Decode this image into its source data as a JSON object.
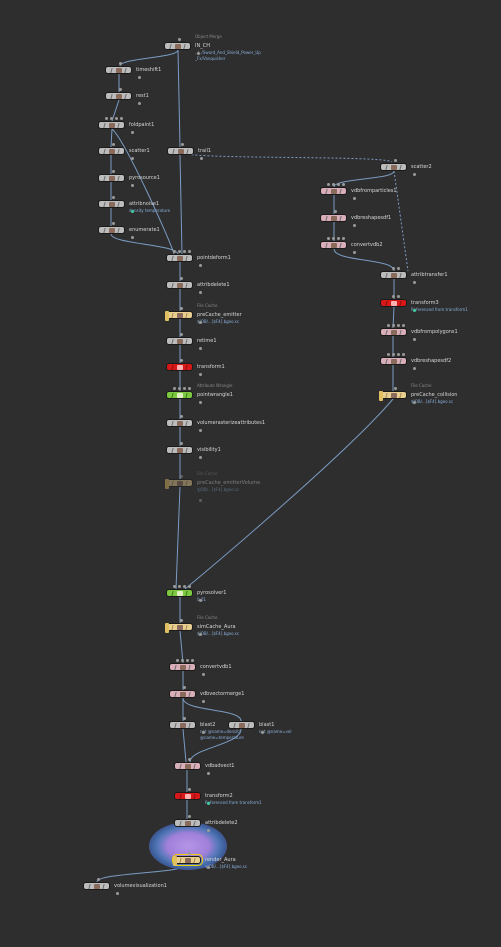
{
  "network": {
    "connection_color": "#7b9cc4",
    "nodes": [
      {
        "key": "in_ch",
        "label": "IN_CH",
        "type_label": "Object Merge",
        "info": "../../Sword_And_Shield_Power_Up",
        "info2": "_Fx/Vanquisher",
        "icon": "merge-icon",
        "color": "#bcbcbc"
      },
      {
        "key": "timeshift1",
        "label": "timeshift1",
        "icon": "clock-icon",
        "color": "#bcbcbc"
      },
      {
        "key": "rest1",
        "label": "rest1",
        "icon": "rest-icon",
        "color": "#bcbcbc"
      },
      {
        "key": "foldpaint1",
        "label": "foldpaint1",
        "icon": "paint-icon",
        "color": "#bcbcbc"
      },
      {
        "key": "scatter1",
        "label": "scatter1",
        "icon": "scatter-icon",
        "color": "#bcbcbc"
      },
      {
        "key": "pyrosource1",
        "label": "pyrosource1",
        "icon": "fire-icon",
        "color": "#bcbcbc"
      },
      {
        "key": "attribnoise1",
        "label": "attribnoise1",
        "info": "density temperature",
        "icon": "noise-icon",
        "color": "#bcbcbc"
      },
      {
        "key": "enumerate1",
        "label": "enumerate1",
        "icon": "enumerate-icon",
        "color": "#bcbcbc"
      },
      {
        "key": "trail1",
        "label": "trail1",
        "icon": "trail-icon",
        "color": "#bcbcbc"
      },
      {
        "key": "pointdeform1",
        "label": "pointdeform1",
        "icon": "deform-icon",
        "color": "#bcbcbc"
      },
      {
        "key": "attribdelete1",
        "label": "attribdelete1",
        "icon": "delete-attr-icon",
        "color": "#bcbcbc"
      },
      {
        "key": "precache_emitter",
        "label": "preCache_emitter",
        "type_label": "File Cache",
        "info": "$JOB/...[$F4].bgeo.sc",
        "icon": "file-cache-icon",
        "color": "#e8cf90"
      },
      {
        "key": "retime1",
        "label": "retime1",
        "icon": "retime-icon",
        "color": "#bcbcbc"
      },
      {
        "key": "transform1",
        "label": "transform1",
        "icon": "transform-icon",
        "color": "#d81818"
      },
      {
        "key": "pointwrangle1",
        "label": "pointwrangle1",
        "type_label": "Attribute Wrangle",
        "icon": "wrangle-icon",
        "color": "#7cc840"
      },
      {
        "key": "volumerasterize",
        "label": "volumerasterizeattributes1",
        "icon": "volume-icon",
        "color": "#bcbcbc"
      },
      {
        "key": "visibility1",
        "label": "visibility1",
        "icon": "eye-icon",
        "color": "#bcbcbc"
      },
      {
        "key": "precache_emitter_volume",
        "label": "preCache_emitterVolume",
        "type_label": "File Cache",
        "info": "$JOB/...[$F4].bgeo.sc",
        "icon": "file-cache-icon",
        "color": "#e8cf90"
      },
      {
        "key": "scatter2",
        "label": "scatter2",
        "icon": "scatter-icon",
        "color": "#bcbcbc"
      },
      {
        "key": "vdbfromparticles",
        "label": "vdbfromparticles1",
        "icon": "vdb-icon",
        "color": "#d9aeb8"
      },
      {
        "key": "vdbreshapesdf1",
        "label": "vdbreshapesdf1",
        "icon": "vdb-icon",
        "color": "#d9aeb8"
      },
      {
        "key": "convertvdb2",
        "label": "convertvdb2",
        "icon": "vdb-icon",
        "color": "#d9aeb8"
      },
      {
        "key": "attribtransfer1",
        "label": "attribtransfer1",
        "icon": "transfer-icon",
        "color": "#bcbcbc"
      },
      {
        "key": "transform3",
        "label": "transform3",
        "info": "Referenced from transform1",
        "icon": "transform-icon",
        "color": "#d81818"
      },
      {
        "key": "vdbfrompolygons1",
        "label": "vdbfrompolygons1",
        "icon": "vdb-icon",
        "color": "#d9aeb8"
      },
      {
        "key": "vdbreshapesdf2",
        "label": "vdbreshapesdf2",
        "icon": "vdb-icon",
        "color": "#d9aeb8"
      },
      {
        "key": "precache_collision",
        "label": "preCache_collision",
        "type_label": "File Cache",
        "info": "$JOB/...[$F4].bgeo.sc",
        "icon": "file-cache-icon",
        "color": "#e8cf90"
      },
      {
        "key": "pyrosolver1",
        "label": "pyrosolver1",
        "info": "0.01",
        "icon": "pyro-icon",
        "color": "#7cc840"
      },
      {
        "key": "simcache_aura",
        "label": "simCache_Aura",
        "type_label": "File Cache",
        "info": "$JOB/...[$F4].bgeo.sc",
        "icon": "file-cache-icon",
        "color": "#e8cf90"
      },
      {
        "key": "convertvdb1",
        "label": "convertvdb1",
        "icon": "vdb-icon",
        "color": "#d9aeb8"
      },
      {
        "key": "vdbvectormerge1",
        "label": "vdbvectormerge1",
        "icon": "vdb-icon",
        "color": "#d9aeb8"
      },
      {
        "key": "blast2",
        "label": "blast2",
        "info": "not @name=density",
        "info2": "@name=temperature",
        "icon": "blast-icon",
        "color": "#bcbcbc"
      },
      {
        "key": "blast1",
        "label": "blast1",
        "info": "not @name=vel",
        "icon": "blast-icon",
        "color": "#bcbcbc"
      },
      {
        "key": "vdbadvect1",
        "label": "vdbadvect1",
        "icon": "vdb-icon",
        "color": "#d9aeb8"
      },
      {
        "key": "transform2",
        "label": "transform2",
        "info": "Referenced from transform1",
        "icon": "transform-icon",
        "color": "#d81818"
      },
      {
        "key": "attribdelete2",
        "label": "attribdelete2",
        "icon": "delete-attr-icon",
        "color": "#bcbcbc"
      },
      {
        "key": "render_aura",
        "label": "render_Aura",
        "info": "$JOB/...[$F4].bgeo.sc",
        "icon": "render-icon",
        "color": "#e8cf90"
      },
      {
        "key": "volumevisualization1",
        "label": "volumevisualization1",
        "icon": "visualize-icon",
        "color": "#bcbcbc"
      }
    ]
  }
}
